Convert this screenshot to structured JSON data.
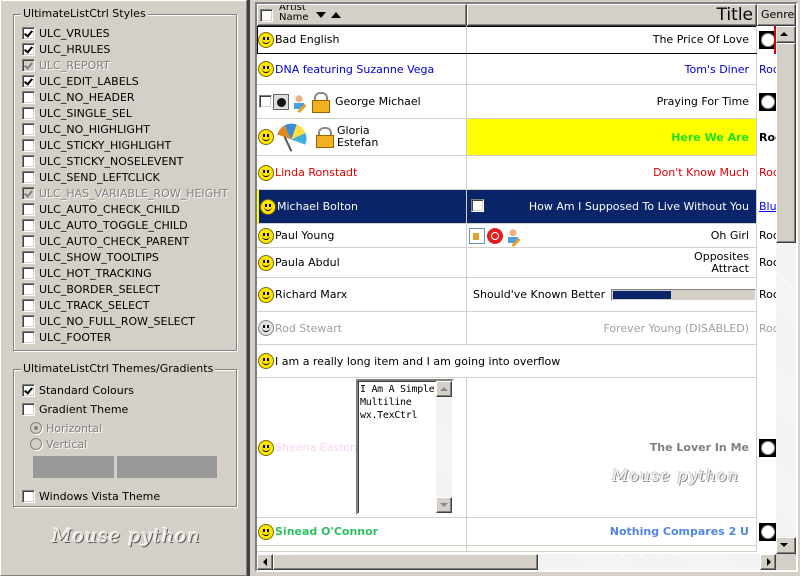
{
  "styles_panel": {
    "title": "UltimateListCtrl Styles",
    "options": [
      {
        "label": "ULC_VRULES",
        "checked": true,
        "disabled": false
      },
      {
        "label": "ULC_HRULES",
        "checked": true,
        "disabled": false
      },
      {
        "label": "ULC_REPORT",
        "checked": true,
        "disabled": true
      },
      {
        "label": "ULC_EDIT_LABELS",
        "checked": true,
        "disabled": false
      },
      {
        "label": "ULC_NO_HEADER",
        "checked": false,
        "disabled": false
      },
      {
        "label": "ULC_SINGLE_SEL",
        "checked": false,
        "disabled": false
      },
      {
        "label": "ULC_NO_HIGHLIGHT",
        "checked": false,
        "disabled": false
      },
      {
        "label": "ULC_STICKY_HIGHLIGHT",
        "checked": false,
        "disabled": false
      },
      {
        "label": "ULC_STICKY_NOSELEVENT",
        "checked": false,
        "disabled": false
      },
      {
        "label": "ULC_SEND_LEFTCLICK",
        "checked": false,
        "disabled": false
      },
      {
        "label": "ULC_HAS_VARIABLE_ROW_HEIGHT",
        "checked": true,
        "disabled": true
      },
      {
        "label": "ULC_AUTO_CHECK_CHILD",
        "checked": false,
        "disabled": false
      },
      {
        "label": "ULC_AUTO_TOGGLE_CHILD",
        "checked": false,
        "disabled": false
      },
      {
        "label": "ULC_AUTO_CHECK_PARENT",
        "checked": false,
        "disabled": false
      },
      {
        "label": "ULC_SHOW_TOOLTIPS",
        "checked": false,
        "disabled": false
      },
      {
        "label": "ULC_HOT_TRACKING",
        "checked": false,
        "disabled": false
      },
      {
        "label": "ULC_BORDER_SELECT",
        "checked": false,
        "disabled": false
      },
      {
        "label": "ULC_TRACK_SELECT",
        "checked": false,
        "disabled": false
      },
      {
        "label": "ULC_NO_FULL_ROW_SELECT",
        "checked": false,
        "disabled": false
      },
      {
        "label": "ULC_FOOTER",
        "checked": false,
        "disabled": false
      }
    ]
  },
  "themes_panel": {
    "title": "UltimateListCtrl Themes/Gradients",
    "standard_colours": {
      "label": "Standard Colours",
      "checked": true
    },
    "gradient_theme": {
      "label": "Gradient Theme",
      "checked": false
    },
    "horizontal": {
      "label": "Horizontal",
      "selected": true,
      "disabled": true
    },
    "vertical": {
      "label": "Vertical",
      "selected": false,
      "disabled": true
    },
    "gradient_color_1": "#999999",
    "gradient_color_2": "#999999",
    "vista_theme": {
      "label": "Windows Vista Theme",
      "checked": false
    }
  },
  "logo_text": "Mouse python",
  "list": {
    "columns": [
      {
        "label": "Artist Name"
      },
      {
        "label": "Title"
      },
      {
        "label": "Genre"
      }
    ],
    "rows": [
      {
        "artist": "Bad English",
        "title": "The Price Of Love",
        "genre": "",
        "genre_icon": "radio-icon"
      },
      {
        "artist": "DNA featuring Suzanne Vega",
        "title": "Tom's Diner",
        "genre": "Rock"
      },
      {
        "artist": "George Michael",
        "title": "Praying For Time",
        "genre": "",
        "genre_icon": "radio-icon"
      },
      {
        "artist": "Gloria\nEstefan",
        "title": "Here We Are",
        "genre": "Rock"
      },
      {
        "artist": "Linda Ronstadt",
        "title": "Don't Know Much",
        "genre": "Rock"
      },
      {
        "artist": "Michael Bolton",
        "title": "How Am I Supposed To Live Without You",
        "genre": "Blues"
      },
      {
        "artist": "Paul Young",
        "title": "Oh Girl",
        "genre": "Rock"
      },
      {
        "artist": "Paula Abdul",
        "title": "Opposites\nAttract",
        "genre": "Rock"
      },
      {
        "artist": "Richard Marx",
        "title": "Should've Known Better",
        "genre": "Rock",
        "progress_percent": 42
      },
      {
        "artist": "Rod Stewart",
        "title": "Forever Young (DISABLED)",
        "genre": "Rock"
      },
      {
        "artist": "I am a really long item and I am going into overflow",
        "title": "",
        "genre": ""
      },
      {
        "artist": "Sheena Easton",
        "title": "The Lover In Me",
        "genre": "",
        "genre_icon": "radio-icon",
        "textctrl_value": "I Am A Simple\nMultiline\nwx.TexCtrl"
      },
      {
        "artist": "Sinead O'Connor",
        "title": "Nothing Compares 2 U",
        "genre": "",
        "genre_icon": "radio-icon"
      }
    ]
  },
  "colors": {
    "selection": "#0a246a",
    "highlight_yellow": "#ffff00",
    "blue_text": "#0000d0",
    "red_text": "#e00000",
    "green_text": "#20e020"
  }
}
